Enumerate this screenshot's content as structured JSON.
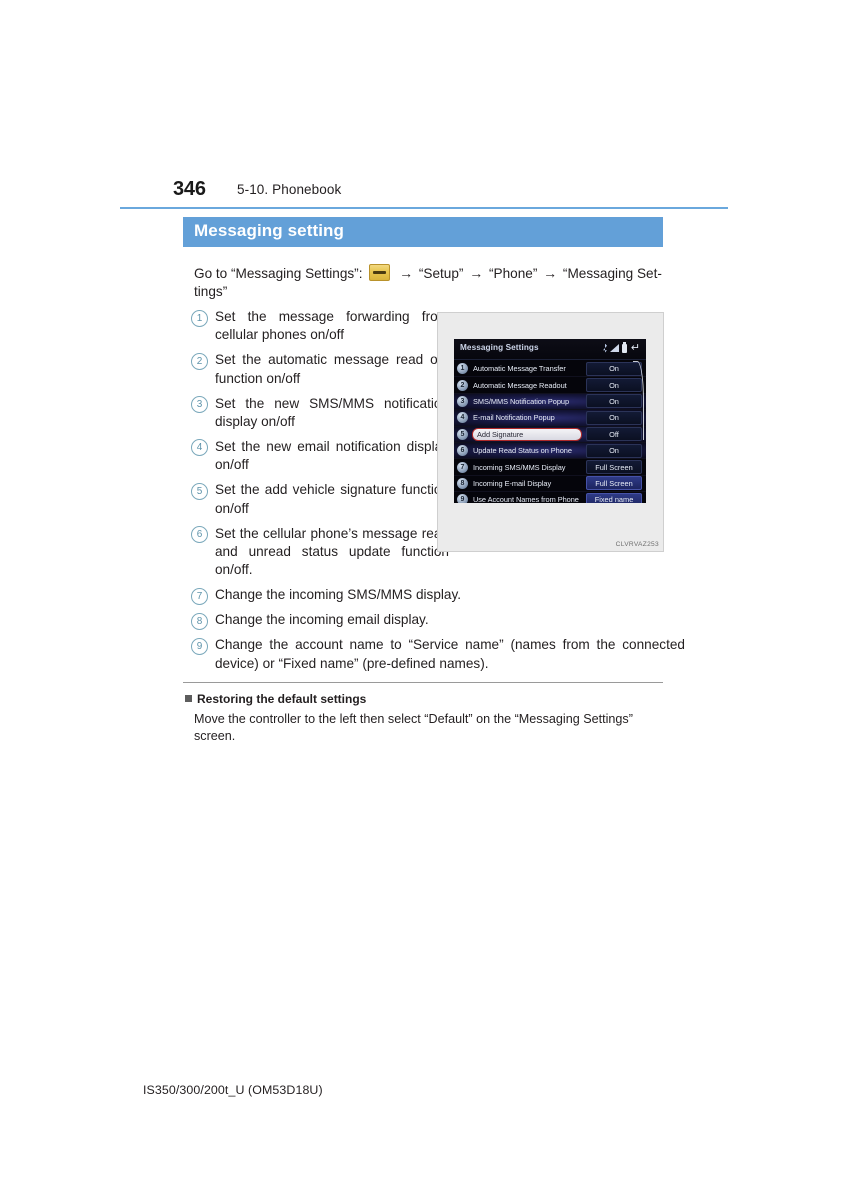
{
  "page": {
    "number": "346",
    "breadcrumb": "5-10. Phonebook",
    "footer": "IS350/300/200t_U (OM53D18U)",
    "accent_color": "#63a0d8",
    "rule_color": "#6aa8dd"
  },
  "section": {
    "heading": "Messaging setting"
  },
  "intro": {
    "lead": "Go to “Messaging Settings”:",
    "menu_icon": "menu-button-icon",
    "arrow": "→",
    "step1": "“Setup”",
    "step2": "“Phone”",
    "step3": "“Messaging Set-",
    "step3_tail": "tings”"
  },
  "callouts": [
    {
      "num": "1",
      "text": "Set the message forwarding from cellular phones on/off",
      "width": "narrow"
    },
    {
      "num": "2",
      "text": "Set the automatic message read out function on/off",
      "width": "narrow"
    },
    {
      "num": "3",
      "text": "Set the new SMS/MMS notification display on/off",
      "width": "narrow"
    },
    {
      "num": "4",
      "text": "Set the new email notification display on/off",
      "width": "narrow"
    },
    {
      "num": "5",
      "text": "Set the add vehicle signature function on/off",
      "width": "narrow"
    },
    {
      "num": "6",
      "text": "Set the cellular phone’s message read and unread status update function on/off.",
      "width": "narrow"
    },
    {
      "num": "7",
      "text": "Change the incoming SMS/MMS display.",
      "width": "wide-single"
    },
    {
      "num": "8",
      "text": "Change the incoming email display.",
      "width": "wide-single"
    },
    {
      "num": "9",
      "text": "Change the account name to “Service name” (names from the connected device) or “Fixed name” (pre-defined names).",
      "width": "wide"
    }
  ],
  "figure": {
    "caption": "CLVRVAZ253",
    "screen": {
      "title": "Messaging Settings",
      "status_icons": [
        "bluetooth-icon",
        "signal-icon",
        "battery-icon",
        "back-arrow-icon"
      ],
      "rows": [
        {
          "num": "1",
          "label": "Automatic Message Transfer",
          "value": "On",
          "value_style": "normal",
          "state": "normal",
          "glow": false
        },
        {
          "num": "2",
          "label": "Automatic  Message Readout",
          "value": "On",
          "value_style": "normal",
          "state": "normal",
          "glow": false
        },
        {
          "num": "3",
          "label": "SMS/MMS Notification Popup",
          "value": "On",
          "value_style": "normal",
          "state": "normal",
          "glow": true
        },
        {
          "num": "4",
          "label": "E-mail Notification Popup",
          "value": "On",
          "value_style": "normal",
          "state": "normal",
          "glow": true
        },
        {
          "num": "5",
          "label": "Add Signature",
          "value": "Off",
          "value_style": "normal",
          "state": "selected",
          "glow": true
        },
        {
          "num": "6",
          "label": "Update Read Status on Phone",
          "value": "On",
          "value_style": "normal",
          "state": "normal",
          "glow": true
        },
        {
          "num": "7",
          "label": "Incoming SMS/MMS Display",
          "value": "Full Screen",
          "value_style": "normal",
          "state": "normal",
          "glow": false
        },
        {
          "num": "8",
          "label": "Incoming E-mail Display",
          "value": "Full Screen",
          "value_style": "bright",
          "state": "normal",
          "glow": false
        },
        {
          "num": "9",
          "label": "Use Account Names from Phone",
          "value": "Fixed name",
          "value_style": "bright",
          "state": "normal",
          "glow": false
        }
      ]
    }
  },
  "note": {
    "heading": "Restoring the default settings",
    "body": "Move the controller to the left then select “Default” on the “Messaging Settings” screen."
  }
}
